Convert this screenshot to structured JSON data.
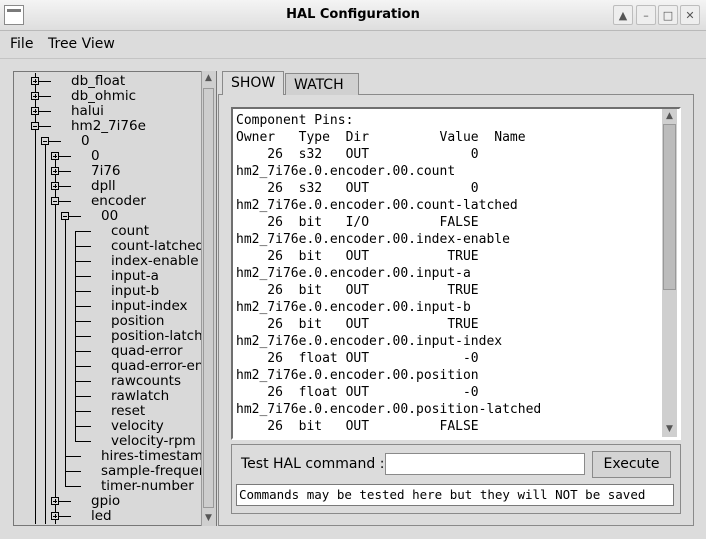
{
  "window": {
    "title": "HAL Configuration"
  },
  "menu": [
    {
      "label": "File"
    },
    {
      "label": "Tree View"
    }
  ],
  "tree": {
    "items": [
      {
        "label": "db_float",
        "depth": 0,
        "toggle": "plus"
      },
      {
        "label": "db_ohmic",
        "depth": 0,
        "toggle": "plus"
      },
      {
        "label": "halui",
        "depth": 0,
        "toggle": "plus"
      },
      {
        "label": "hm2_7i76e",
        "depth": 0,
        "toggle": "minus"
      },
      {
        "label": "0",
        "depth": 1,
        "toggle": "minus"
      },
      {
        "label": "0",
        "depth": 2,
        "toggle": "plus"
      },
      {
        "label": "7i76",
        "depth": 2,
        "toggle": "plus"
      },
      {
        "label": "dpll",
        "depth": 2,
        "toggle": "plus"
      },
      {
        "label": "encoder",
        "depth": 2,
        "toggle": "minus"
      },
      {
        "label": "00",
        "depth": 3,
        "toggle": "minus"
      },
      {
        "label": "count",
        "depth": 4,
        "toggle": "none"
      },
      {
        "label": "count-latched",
        "depth": 4,
        "toggle": "none"
      },
      {
        "label": "index-enable",
        "depth": 4,
        "toggle": "none"
      },
      {
        "label": "input-a",
        "depth": 4,
        "toggle": "none"
      },
      {
        "label": "input-b",
        "depth": 4,
        "toggle": "none"
      },
      {
        "label": "input-index",
        "depth": 4,
        "toggle": "none"
      },
      {
        "label": "position",
        "depth": 4,
        "toggle": "none"
      },
      {
        "label": "position-latched",
        "depth": 4,
        "toggle": "none"
      },
      {
        "label": "quad-error",
        "depth": 4,
        "toggle": "none"
      },
      {
        "label": "quad-error-enable",
        "depth": 4,
        "toggle": "none"
      },
      {
        "label": "rawcounts",
        "depth": 4,
        "toggle": "none"
      },
      {
        "label": "rawlatch",
        "depth": 4,
        "toggle": "none"
      },
      {
        "label": "reset",
        "depth": 4,
        "toggle": "none"
      },
      {
        "label": "velocity",
        "depth": 4,
        "toggle": "none"
      },
      {
        "label": "velocity-rpm",
        "depth": 4,
        "toggle": "none"
      },
      {
        "label": "hires-timestamp",
        "depth": 3,
        "toggle": "none"
      },
      {
        "label": "sample-frequency",
        "depth": 3,
        "toggle": "none"
      },
      {
        "label": "timer-number",
        "depth": 3,
        "toggle": "none"
      },
      {
        "label": "gpio",
        "depth": 2,
        "toggle": "plus"
      },
      {
        "label": "led",
        "depth": 2,
        "toggle": "plus"
      }
    ]
  },
  "tabs": [
    {
      "label": "SHOW",
      "active": true
    },
    {
      "label": "WATCH",
      "active": false
    }
  ],
  "output": {
    "lines": [
      "Component Pins:",
      "Owner   Type  Dir         Value  Name",
      "    26  s32   OUT             0",
      "hm2_7i76e.0.encoder.00.count",
      "    26  s32   OUT             0",
      "hm2_7i76e.0.encoder.00.count-latched",
      "    26  bit   I/O         FALSE",
      "hm2_7i76e.0.encoder.00.index-enable",
      "    26  bit   OUT          TRUE",
      "hm2_7i76e.0.encoder.00.input-a",
      "    26  bit   OUT          TRUE",
      "hm2_7i76e.0.encoder.00.input-b",
      "    26  bit   OUT          TRUE",
      "hm2_7i76e.0.encoder.00.input-index",
      "    26  float OUT            -0",
      "hm2_7i76e.0.encoder.00.position",
      "    26  float OUT            -0",
      "hm2_7i76e.0.encoder.00.position-latched",
      "    26  bit   OUT         FALSE"
    ]
  },
  "command": {
    "label": "Test HAL command :",
    "value": "",
    "execute_label": "Execute",
    "status": "Commands may be tested here but they will NOT be saved"
  }
}
